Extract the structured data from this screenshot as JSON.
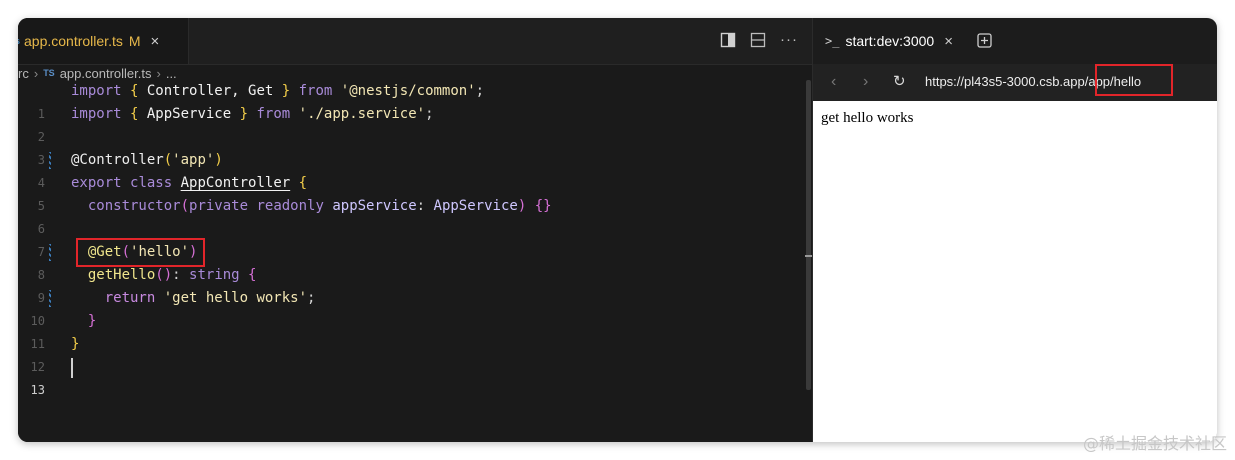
{
  "editor": {
    "tab": {
      "badge": "s",
      "filename": "app.controller.ts",
      "modified": "M",
      "close": "×"
    },
    "actions": {
      "more": "···"
    },
    "breadcrumb": {
      "folder": "rc",
      "lang_badge": "TS",
      "file": "app.controller.ts",
      "ellipsis": "..."
    },
    "line_numbers": [
      "1",
      "2",
      "3",
      "4",
      "5",
      "6",
      "7",
      "8",
      "9",
      "10",
      "11",
      "12",
      "13"
    ],
    "code": {
      "l1": {
        "kw1": "import",
        "b1": "{",
        "t1": " Controller, Get ",
        "b2": "}",
        "kw2": "from",
        "s": "'@nestjs/common'",
        "end": ";"
      },
      "l2": {
        "kw1": "import",
        "b1": "{",
        "t1": " AppService ",
        "b2": "}",
        "kw2": "from",
        "s": "'./app.service'",
        "end": ";"
      },
      "l4": {
        "dec": "@Controller",
        "p1": "(",
        "s": "'app'",
        "p2": ")"
      },
      "l5": {
        "kw1": "export",
        "kw2": "class",
        "cls": "AppController",
        "b": "{"
      },
      "l6": {
        "fn": "constructor",
        "p1": "(",
        "kw1": "private",
        "kw2": "readonly",
        "param": "appService",
        "colon": ":",
        "type": "AppService",
        "p2": ")",
        "body": "{}"
      },
      "l8": {
        "dec": "@Get",
        "p1": "(",
        "s": "'hello'",
        "p2": ")"
      },
      "l9": {
        "fn": "getHello",
        "parens": "()",
        "colon": ":",
        "type": "string",
        "b": "{"
      },
      "l10": {
        "kw": "return",
        "s": "'get hello works'",
        "end": ";"
      },
      "l11": {
        "b": "}"
      },
      "l12": {
        "b": "}"
      }
    }
  },
  "browser": {
    "tab": {
      "term_icon": ">_",
      "title": "start:dev:3000",
      "close": "×"
    },
    "nav": {
      "back": "‹",
      "forward": "›",
      "reload": "↻"
    },
    "url": {
      "base": "https://pl43s5-3000.csb.ap",
      "path": "p/app/hello"
    },
    "page_text": "get hello works"
  },
  "colors": {
    "highlight": "#e2252a",
    "accent_badge": "#4a90c8"
  },
  "watermark": "@稀土掘金技术社区"
}
